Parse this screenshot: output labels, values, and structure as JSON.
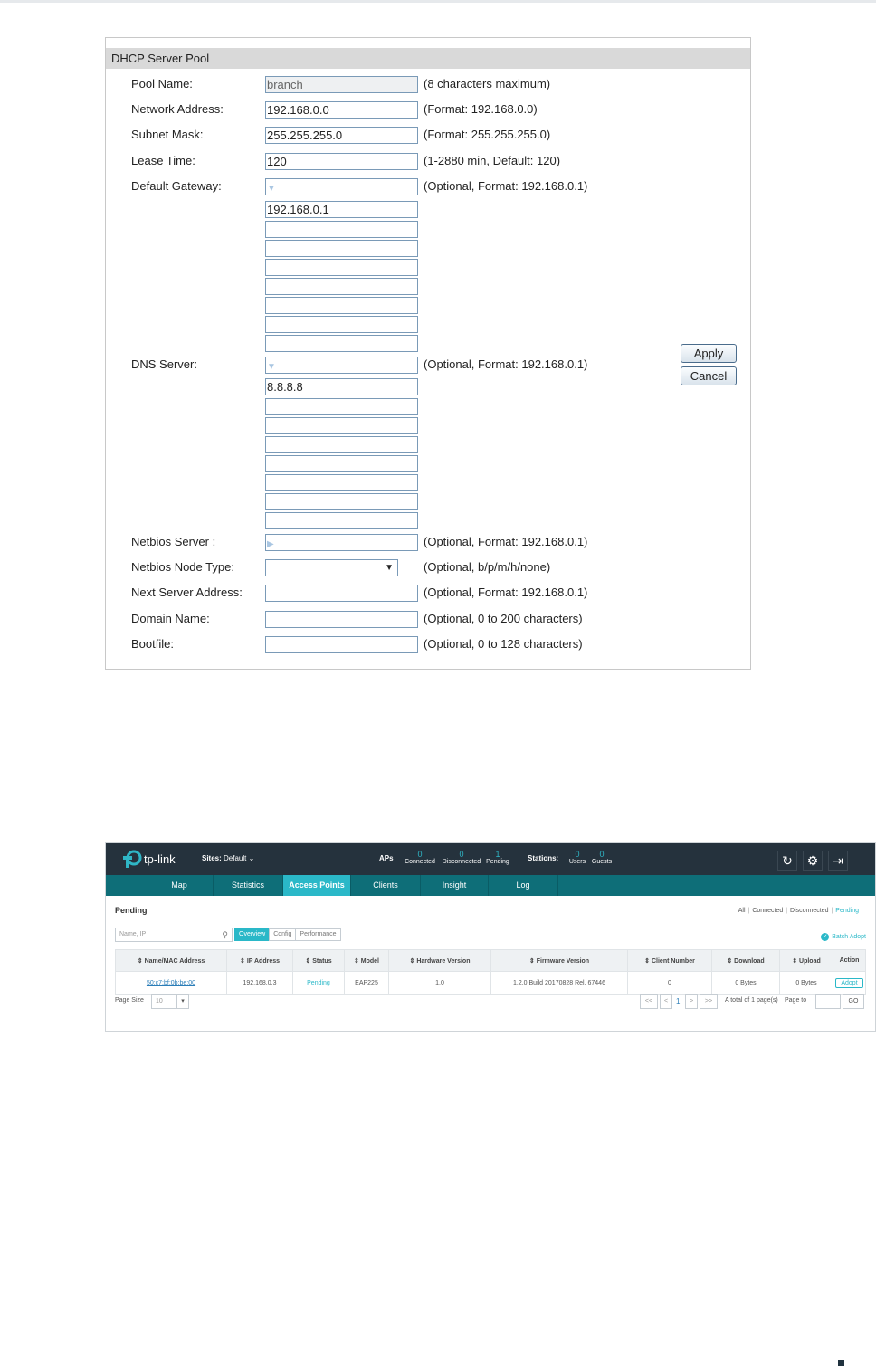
{
  "dhcp": {
    "title": "DHCP Server Pool",
    "labels": {
      "pool_name": "Pool Name:",
      "network_address": "Network Address:",
      "subnet_mask": "Subnet Mask:",
      "lease_time": "Lease Time:",
      "default_gateway": "Default Gateway:",
      "dns_server": "DNS Server:",
      "netbios_server": "Netbios Server :",
      "netbios_node_type": "Netbios Node Type:",
      "next_server_address": "Next Server Address:",
      "domain_name": "Domain Name:",
      "bootfile": "Bootfile:"
    },
    "values": {
      "pool_name": "branch",
      "network_address": "192.168.0.0",
      "subnet_mask": "255.255.255.0",
      "lease_time": "120",
      "gateway_1": "192.168.0.1",
      "dns_1": "8.8.8.8",
      "netbios_node_type": ""
    },
    "hints": {
      "pool_name": "(8 characters maximum)",
      "network_address": "(Format: 192.168.0.0)",
      "subnet_mask": "(Format: 255.255.255.0)",
      "lease_time": "(1-2880 min, Default: 120)",
      "default_gateway": "(Optional, Format: 192.168.0.1)",
      "dns_server": "(Optional, Format: 192.168.0.1)",
      "netbios_server": "(Optional, Format: 192.168.0.1)",
      "netbios_node_type": "(Optional, b/p/m/h/none)",
      "next_server_address": "(Optional, Format: 192.168.0.1)",
      "domain_name": "(Optional, 0 to 200 characters)",
      "bootfile": "(Optional, 0 to 128 characters)"
    },
    "buttons": {
      "apply": "Apply",
      "cancel": "Cancel"
    }
  },
  "omada": {
    "brand": "tp-link",
    "sites_label": "Sites:",
    "site_value": "Default",
    "aps_label": "APs",
    "aps": [
      {
        "count": "0",
        "label": "Connected"
      },
      {
        "count": "0",
        "label": "Disconnected"
      },
      {
        "count": "1",
        "label": "Pending"
      }
    ],
    "stations_label": "Stations:",
    "stations": [
      {
        "count": "0",
        "label": "Users"
      },
      {
        "count": "0",
        "label": "Guests"
      }
    ],
    "nav": [
      "Map",
      "Statistics",
      "Access Points",
      "Clients",
      "Insight",
      "Log"
    ],
    "active_nav": "Access Points",
    "section_title": "Pending",
    "filters": [
      "All",
      "Connected",
      "Disconnected",
      "Pending"
    ],
    "search_placeholder": "Name, IP",
    "view_tabs": [
      "Overview",
      "Config",
      "Performance"
    ],
    "batch_adopt": "Batch Adopt",
    "columns": [
      "Name/MAC Address",
      "IP Address",
      "Status",
      "Model",
      "Hardware Version",
      "Firmware Version",
      "Client Number",
      "Download",
      "Upload",
      "Action"
    ],
    "rows": [
      {
        "name": "50:c7:bf:0b:be:00",
        "ip": "192.168.0.3",
        "status": "Pending",
        "model": "EAP225",
        "hw": "1.0",
        "fw": "1.2.0 Build 20170828 Rel. 67446",
        "clients": "0",
        "download": "0 Bytes",
        "upload": "0 Bytes",
        "action": "Adopt"
      }
    ],
    "page_size_label": "Page Size",
    "page_size": "10",
    "pager": {
      "first": "<<",
      "prev": "<",
      "current": "1",
      "next": ">",
      "last": ">>"
    },
    "total_text": "A total of 1 page(s)",
    "page_to_label": "Page to",
    "go_label": "GO"
  }
}
